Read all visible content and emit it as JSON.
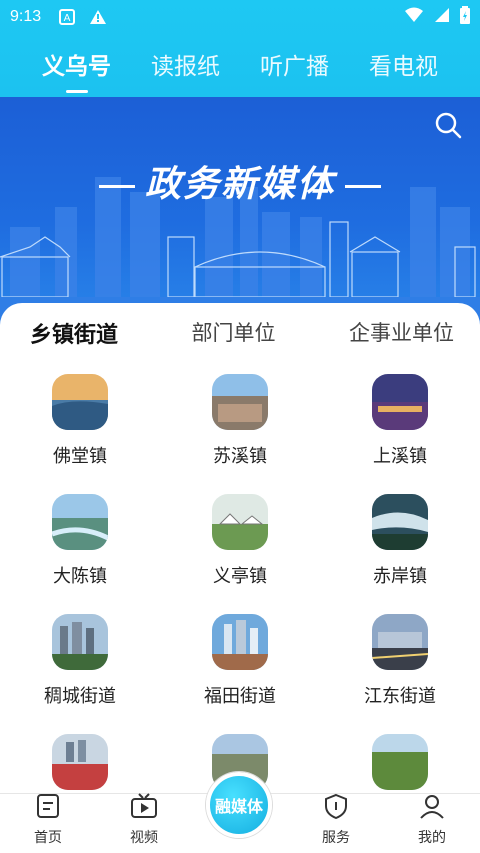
{
  "status": {
    "time": "9:13"
  },
  "top_tabs": [
    {
      "label": "义乌号",
      "active": true
    },
    {
      "label": "读报纸",
      "active": false
    },
    {
      "label": "听广播",
      "active": false
    },
    {
      "label": "看电视",
      "active": false
    }
  ],
  "banner": {
    "headline": "政务新媒体"
  },
  "sub_tabs": [
    {
      "label": "乡镇街道",
      "active": true
    },
    {
      "label": "部门单位",
      "active": false
    },
    {
      "label": "企事业单位",
      "active": false
    }
  ],
  "items": [
    {
      "name": "佛堂镇",
      "icon": "town-photo-icon"
    },
    {
      "name": "苏溪镇",
      "icon": "town-photo-icon"
    },
    {
      "name": "上溪镇",
      "icon": "town-photo-icon"
    },
    {
      "name": "大陈镇",
      "icon": "town-photo-icon"
    },
    {
      "name": "义亭镇",
      "icon": "town-photo-icon"
    },
    {
      "name": "赤岸镇",
      "icon": "town-photo-icon"
    },
    {
      "name": "稠城街道",
      "icon": "town-photo-icon"
    },
    {
      "name": "福田街道",
      "icon": "town-photo-icon"
    },
    {
      "name": "江东街道",
      "icon": "town-photo-icon"
    },
    {
      "name": "",
      "icon": "town-photo-icon"
    },
    {
      "name": "",
      "icon": "town-photo-icon"
    },
    {
      "name": "",
      "icon": "town-photo-icon"
    }
  ],
  "bottom_nav": {
    "home": "首页",
    "video": "视频",
    "center": "融媒体",
    "service": "服务",
    "mine": "我的"
  },
  "colors": {
    "top_bar": "#1ec8f3",
    "banner": "#1f6de0",
    "accent": "#2eb4f0"
  }
}
